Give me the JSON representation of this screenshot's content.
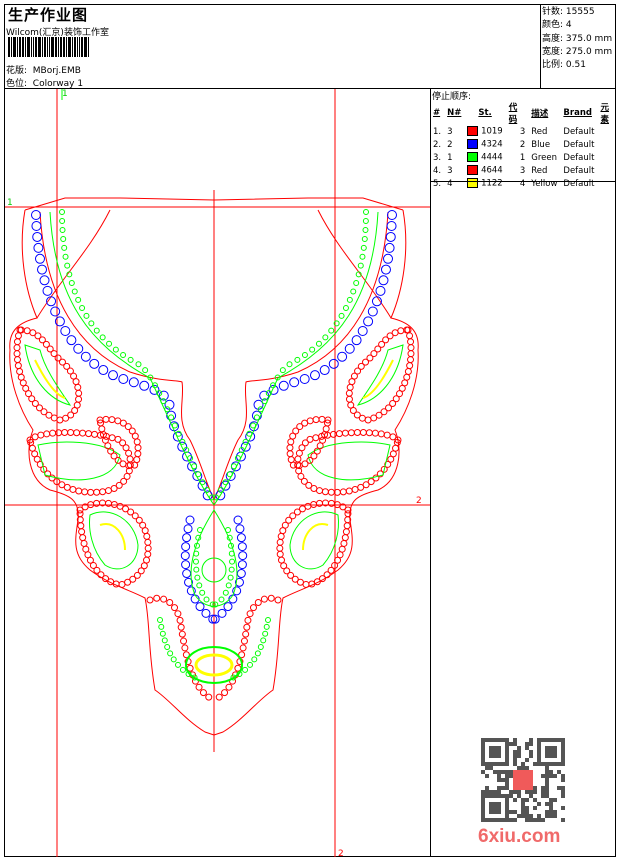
{
  "header": {
    "title": "生产作业图",
    "studio": "Wilcom(汇京)装饰工作室",
    "design_label": "花版:",
    "design_value": "MBorj.EMB",
    "colorway_label": "色位:",
    "colorway_value": "Colorway 1"
  },
  "stats": [
    {
      "label": "针数:",
      "value": "15555"
    },
    {
      "label": "颜色:",
      "value": "4"
    },
    {
      "label": "高度:",
      "value": "375.0 mm"
    },
    {
      "label": "宽度:",
      "value": "275.0 mm"
    },
    {
      "label": "比例:",
      "value": "0.51"
    }
  ],
  "stop_sequence": {
    "title": "停止顺序:",
    "columns": [
      "#",
      "N#",
      "St.",
      "代码",
      "描述",
      "Brand",
      "元素"
    ],
    "rows": [
      {
        "num": "1.",
        "n": "3",
        "color": "#ff0000",
        "st": "1019",
        "code": "3",
        "desc": "Red",
        "brand": "Default"
      },
      {
        "num": "2.",
        "n": "2",
        "color": "#0000ff",
        "st": "4324",
        "code": "2",
        "desc": "Blue",
        "brand": "Default"
      },
      {
        "num": "3.",
        "n": "1",
        "color": "#00ff00",
        "st": "4444",
        "code": "1",
        "desc": "Green",
        "brand": "Default"
      },
      {
        "num": "4.",
        "n": "3",
        "color": "#ff0000",
        "st": "4644",
        "code": "3",
        "desc": "Red",
        "brand": "Default"
      },
      {
        "num": "5.",
        "n": "4",
        "color": "#ffff00",
        "st": "1122",
        "code": "4",
        "desc": "Yellow",
        "brand": "Default"
      }
    ]
  },
  "guides": {
    "v1": "1",
    "v2": "2",
    "h1": "1",
    "h2": "2"
  },
  "watermark": "6xiu.com",
  "colors": {
    "red": "#ff0000",
    "blue": "#0000ff",
    "green": "#00ff00",
    "yellow": "#ffff00"
  }
}
